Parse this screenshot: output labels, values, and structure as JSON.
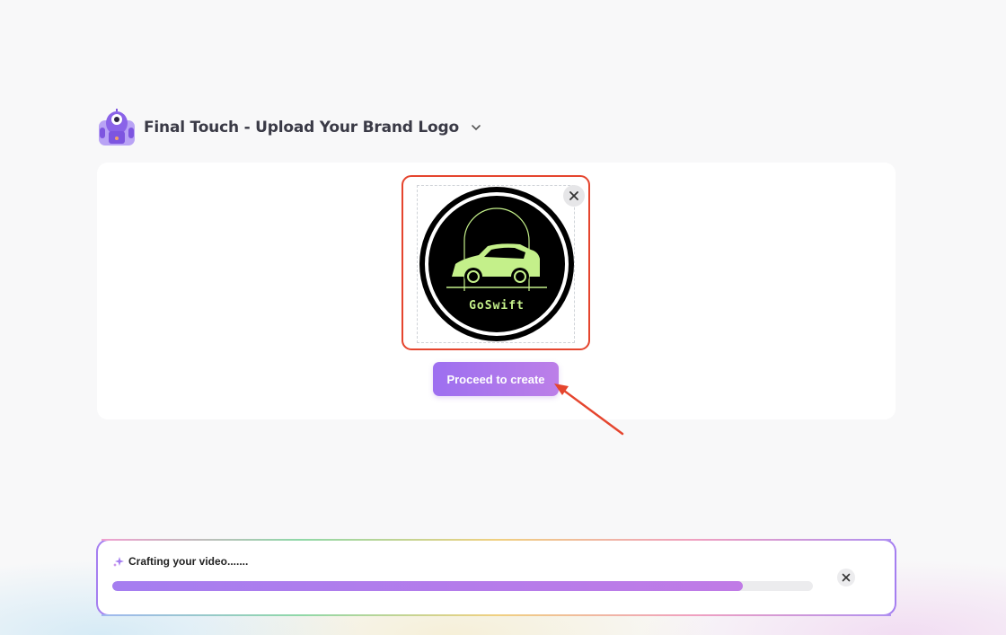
{
  "header": {
    "title": "Final Touch - Upload Your Brand Logo",
    "mascot_icon": "robot-mascot-icon",
    "dropdown_icon": "chevron-down-icon"
  },
  "upload": {
    "logo_text": "GoSwift",
    "remove_icon": "close-icon",
    "proceed_label": "Proceed to create"
  },
  "progress": {
    "label": "Crafting your video.......",
    "sparkle_icon": "sparkle-icon",
    "percent": 90,
    "dismiss_icon": "close-icon"
  },
  "colors": {
    "accent": "#a57ef0",
    "annotation": "#e5452e",
    "logo_green": "#c4f08a"
  }
}
